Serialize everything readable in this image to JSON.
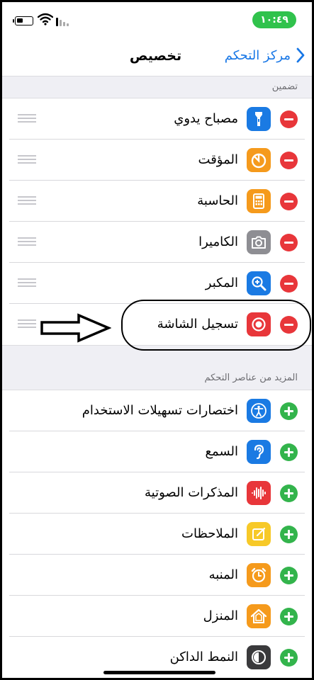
{
  "status_bar": {
    "time": "١٠:٤٩"
  },
  "nav": {
    "title": "تخصيص",
    "back_label": "مركز التحكم"
  },
  "included": {
    "header": "تضمين",
    "items": [
      {
        "label": "مصباح يدوي",
        "icon": "flashlight-icon",
        "color": "#1a7ae3"
      },
      {
        "label": "المؤقت",
        "icon": "timer-icon",
        "color": "#f59a1c"
      },
      {
        "label": "الحاسبة",
        "icon": "calculator-icon",
        "color": "#f59a1c"
      },
      {
        "label": "الكاميرا",
        "icon": "camera-icon",
        "color": "#8e8e93"
      },
      {
        "label": "المكبر",
        "icon": "magnifier-icon",
        "color": "#1a7ae3"
      },
      {
        "label": "تسجيل الشاشة",
        "icon": "screen-recording-icon",
        "color": "#e8363a"
      }
    ]
  },
  "more_controls": {
    "header": "المزيد من عناصر التحكم",
    "items": [
      {
        "label": "اختصارات تسهيلات الاستخدام",
        "icon": "accessibility-icon",
        "color": "#1a7ae3"
      },
      {
        "label": "السمع",
        "icon": "hearing-icon",
        "color": "#1a7ae3"
      },
      {
        "label": "المذكرات الصوتية",
        "icon": "voice-memos-icon",
        "color": "#e8363a"
      },
      {
        "label": "الملاحظات",
        "icon": "notes-icon",
        "color": "#f7c928"
      },
      {
        "label": "المنبه",
        "icon": "alarm-icon",
        "color": "#f59a1c"
      },
      {
        "label": "المنزل",
        "icon": "home-icon",
        "color": "#f59a1c"
      },
      {
        "label": "النمط الداكن",
        "icon": "dark-mode-icon",
        "color": "#3a3a3c"
      }
    ]
  },
  "colors": {
    "accent": "#1877e6",
    "remove": "#e8363a",
    "add": "#33b44c",
    "time_pill": "#30c24c"
  }
}
